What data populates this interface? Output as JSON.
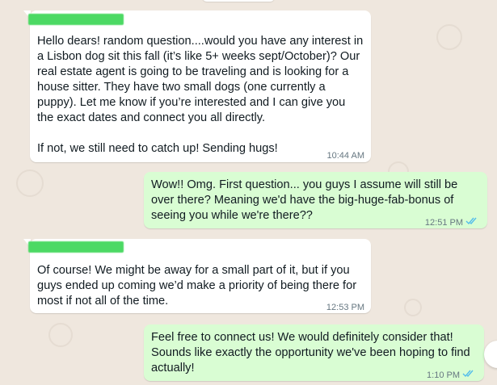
{
  "chat": {
    "messages": [
      {
        "direction": "incoming",
        "sender_name": "",
        "lines": [
          "Hello dears! random question....would you have any interest in",
          "a Lisbon dog sit this fall (it’s like 5+ weeks sept/October)? Our",
          "real estate agent  is going to be traveling and is looking for a",
          "house sitter. They have two small dogs (one currently a",
          "puppy). Let me know if you’re interested and I can give you",
          "the exact dates and connect you all directly.",
          "",
          "If not, we still need to catch up! Sending hugs!"
        ],
        "time": "10:44 AM"
      },
      {
        "direction": "outgoing",
        "lines": [
          "Wow!! Omg. First question... you guys I assume will still be",
          "over there? Meaning we'd have the big-huge-fab-bonus of",
          "seeing you while we're there??"
        ],
        "time": "12:51 PM",
        "read_receipt": "double-check-read-icon"
      },
      {
        "direction": "incoming",
        "sender_name": "",
        "lines": [
          "Of course! We might be away for a small part of it, but if you",
          "guys ended up coming we’d make a priority of being there for",
          "most if not all of the time."
        ],
        "time": "12:53 PM"
      },
      {
        "direction": "outgoing",
        "lines": [
          "Feel free to connect us! We would definitely consider that!",
          "Sounds like exactly the opportunity we've been hoping to find",
          "actually!"
        ],
        "time": "1:10 PM",
        "read_receipt": "double-check-read-icon"
      }
    ]
  },
  "colors": {
    "background": "#efe7de",
    "incoming_bubble": "#ffffff",
    "outgoing_bubble": "#d9fdd3",
    "read_tick": "#53bdeb",
    "name_redaction": "#4cd964",
    "timestamp": "#667781"
  }
}
